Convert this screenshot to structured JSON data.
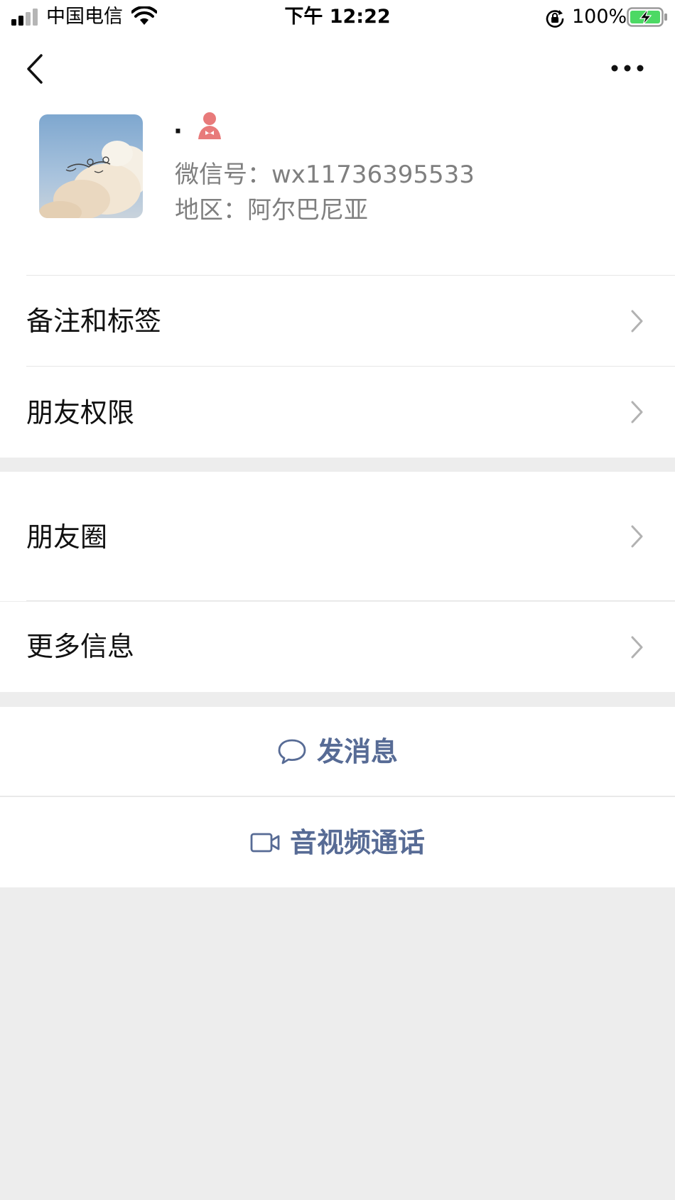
{
  "status_bar": {
    "carrier": "中国电信",
    "time": "下午 12:22",
    "battery_percent": "100%",
    "battery_level": 1.0,
    "icons": [
      "signal-icon",
      "wifi-icon",
      "rotation-lock-icon",
      "battery-charging-icon"
    ]
  },
  "nav": {
    "back_icon": "back-chevron-icon",
    "more_icon": "more-dots-icon"
  },
  "profile": {
    "nickname": "·",
    "gender_icon": "female-icon",
    "gender_color": "#e87a7a",
    "wechat_id": "微信号：wx11736395533",
    "region": "地区：阿尔巴尼亚"
  },
  "menu": {
    "remarks_tags": "备注和标签",
    "friend_permissions": "朋友权限",
    "moments": "朋友圈",
    "more_info": "更多信息"
  },
  "actions": {
    "send_message": "发消息",
    "video_call": "音视频通话",
    "accent_color": "#576b95"
  }
}
